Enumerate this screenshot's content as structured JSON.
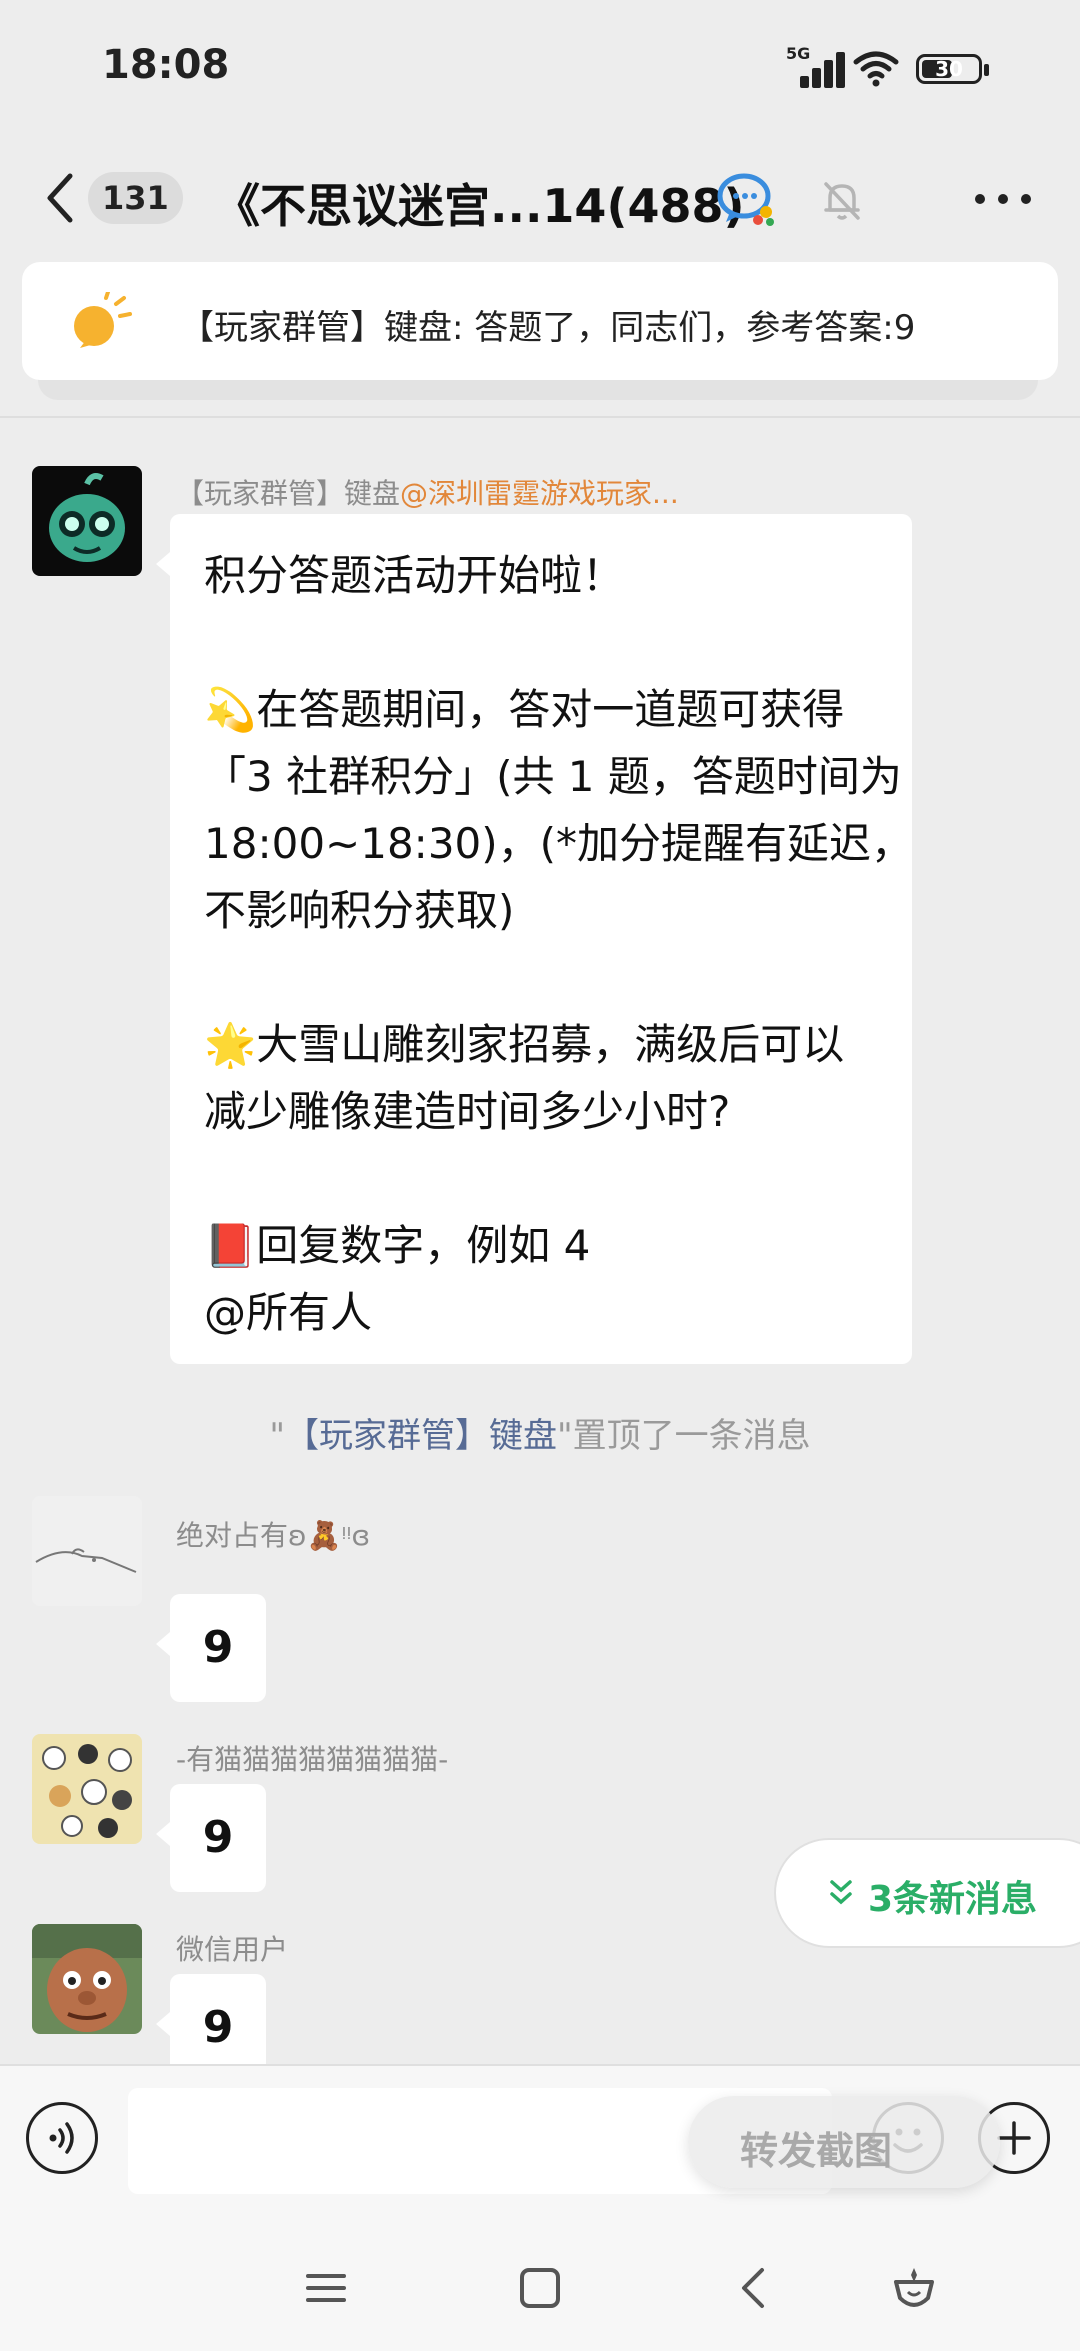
{
  "status_bar": {
    "time": "18:08",
    "network": "5G",
    "battery": "30"
  },
  "header": {
    "unread_count": "131",
    "title": "《不思议迷宫...14(488)",
    "more_label": "•••"
  },
  "pinned": {
    "text": "【玩家群管】键盘: 答题了，同志们，参考答案:9"
  },
  "messages": [
    {
      "sender_prefix": "【玩家群管】键盘",
      "sender_at": "@深圳雷霆游戏玩家...",
      "lines": [
        "积分答题活动开始啦！",
        "",
        "💫在答题期间，答对一道题可获得",
        "「3 社群积分」(共 1 题，答题时间为",
        "18:00~18:30)，(*加分提醒有延迟，",
        "不影响积分获取)",
        "",
        "🌟大雪山雕刻家招募，满级后可以",
        "减少雕像建造时间多少小时?",
        "",
        "📕回复数字，例如 4",
        "@所有人"
      ]
    },
    {
      "sender": "绝对占有ʚ🧸ᵎᵎɞ",
      "text": "9"
    },
    {
      "sender": "-有猫猫猫猫猫猫猫猫-",
      "text": "9"
    },
    {
      "sender": "微信用户",
      "text": "9"
    }
  ],
  "system_notice": {
    "quote_open": "\"",
    "name": "【玩家群管】键盘",
    "quote_close": "\"",
    "suffix": "置顶了一条消息"
  },
  "new_messages_pill": {
    "label": "3条新消息"
  },
  "input_bar": {
    "overlay_label": "转发截图"
  },
  "colors": {
    "accent_green": "#2aae67",
    "mention_orange": "#e2873a",
    "link_blue": "#576b95",
    "background": "#ededed"
  },
  "icons": [
    "back-arrow-icon",
    "group-chat-icon",
    "mute-bell-icon",
    "more-dots-icon",
    "bulb-icon",
    "voice-icon",
    "emoji-icon",
    "plus-icon",
    "menu-icon",
    "home-square-icon",
    "nav-back-icon",
    "assistant-icon",
    "chevron-down-double-icon"
  ]
}
